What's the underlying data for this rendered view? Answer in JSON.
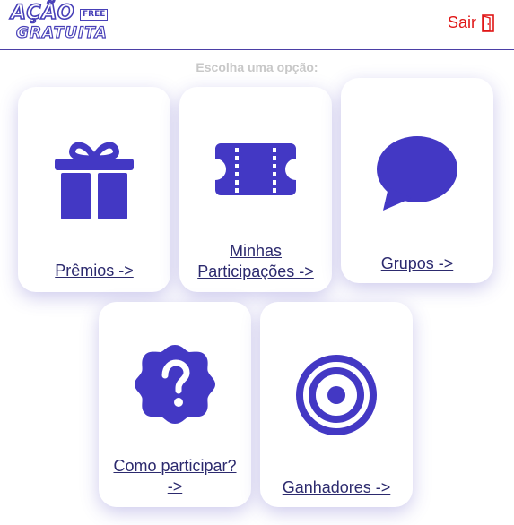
{
  "header": {
    "logo_line1": "AÇÃO",
    "logo_badge": "FREE",
    "logo_line2": "GRATUITA",
    "logout_label": "Sair"
  },
  "prompt": "Escolha uma opção:",
  "cards": [
    {
      "label": "Prêmios ->",
      "icon": "gift-icon"
    },
    {
      "label_line1": "Minhas",
      "label_line2": "Participações ->",
      "icon": "ticket-icon"
    },
    {
      "label": "Grupos ->",
      "icon": "chat-bubble-icon"
    },
    {
      "label_line1": "Como participar?",
      "label_line2": "->",
      "icon": "question-badge-icon"
    },
    {
      "label": "Ganhadores ->",
      "icon": "target-icon"
    }
  ],
  "colors": {
    "accent": "#4338c4",
    "link": "#2c2a6e",
    "logout": "#e01616",
    "prompt": "#c8c8c8"
  }
}
